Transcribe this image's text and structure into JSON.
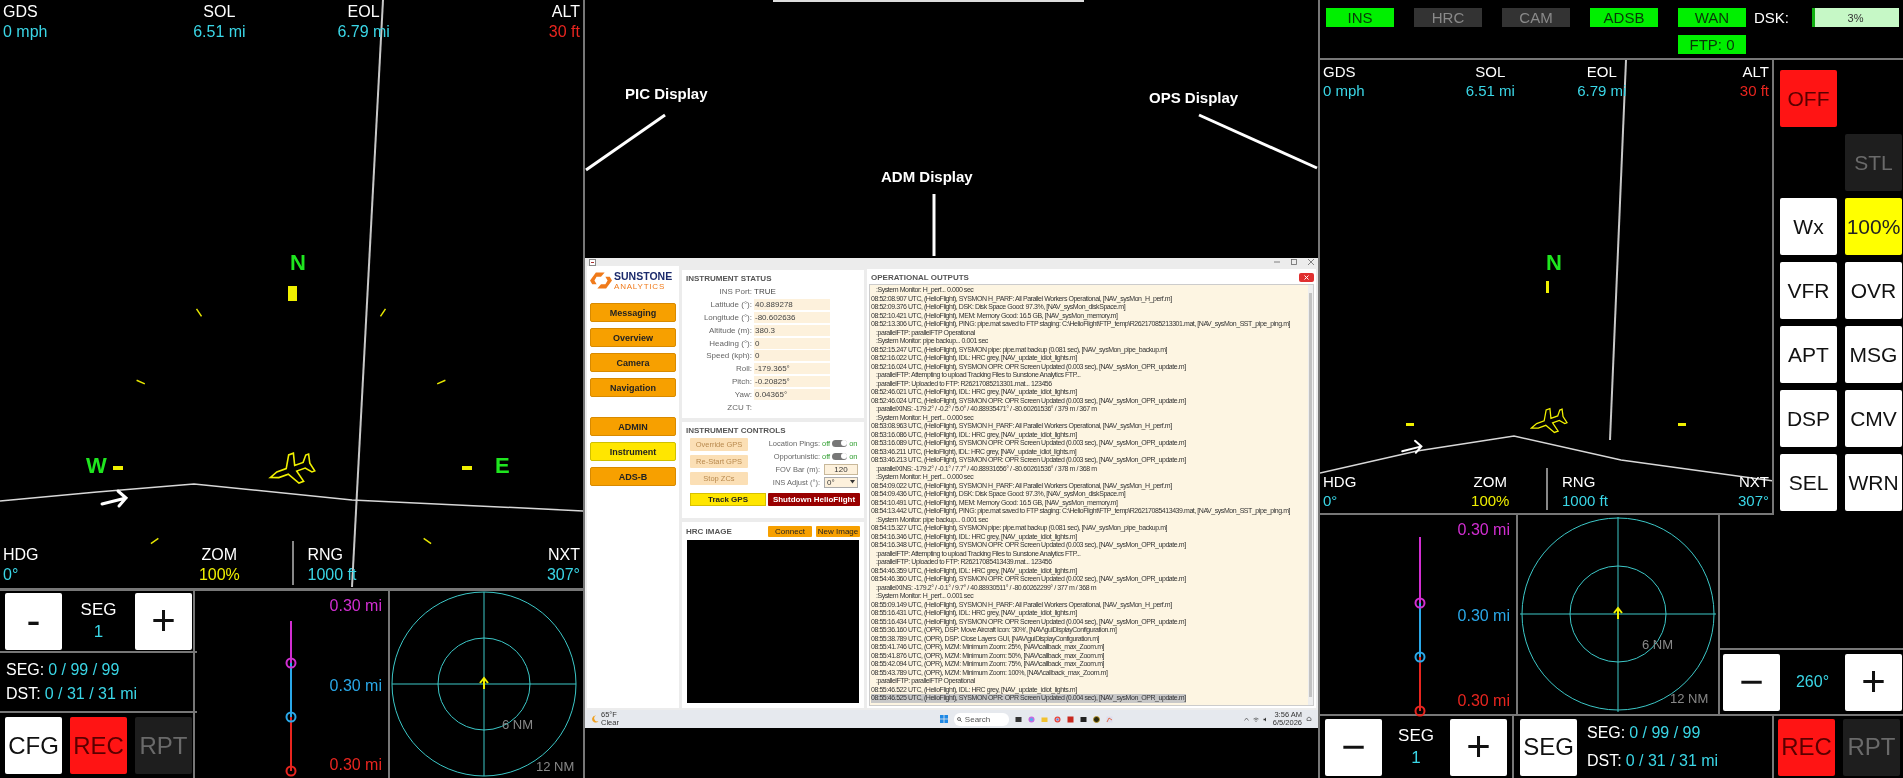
{
  "pic_display": {
    "map": {
      "top": [
        {
          "label": "GDS",
          "value": "0 mph",
          "color": "#3ad6e6"
        },
        {
          "label": "SOL",
          "value": "6.51 mi",
          "color": "#3ad6e6"
        },
        {
          "label": "EOL",
          "value": "6.79 mi",
          "color": "#3ad6e6"
        },
        {
          "label": "ALT",
          "value": "30 ft",
          "color": "#e8251f"
        }
      ],
      "compass": [
        {
          "letter": "N"
        },
        {
          "letter": "W"
        },
        {
          "letter": "E"
        }
      ],
      "bottom": [
        {
          "label": "HDG",
          "value": "0°",
          "color": "#3ad6e6"
        },
        {
          "label": "ZOM",
          "value": "100%",
          "color": "#f0f000"
        },
        {
          "label": "RNG",
          "value": "1000 ft",
          "color": "#3ad6e6"
        },
        {
          "label": "NXT",
          "value": "307°",
          "color": "#3ad6e6"
        }
      ]
    },
    "seg_control": {
      "minus": "-",
      "label": "SEG",
      "value": "1",
      "plus": "+"
    },
    "summary": [
      {
        "label": "SEG:",
        "value": "0 / 99 / 99"
      },
      {
        "label": "DST:",
        "value": "0 / 31 / 31 mi"
      }
    ],
    "buttons": [
      {
        "label": "CFG",
        "kind": "normal"
      },
      {
        "label": "REC",
        "kind": "alert"
      },
      {
        "label": "RPT",
        "kind": "disabled"
      }
    ],
    "profile": [
      {
        "text": "0.30 mi",
        "color": "#d22ed2"
      },
      {
        "text": "0.30 mi",
        "color": "#2aa8e8"
      },
      {
        "text": "0.30 mi",
        "color": "#e8251f"
      }
    ],
    "radar": [
      {
        "label": "6 NM"
      },
      {
        "label": "12 NM"
      }
    ]
  },
  "callouts": [
    {
      "label": "PIC Display"
    },
    {
      "label": "ADM Display"
    },
    {
      "label": "OPS Display"
    }
  ],
  "adm_display": {
    "logo": {
      "name": "SUNSTONE",
      "tagline": "ANALYTICS"
    },
    "nav_groups": [
      {
        "items": [
          {
            "label": "Messaging",
            "selected": false
          },
          {
            "label": "Overview",
            "selected": false
          },
          {
            "label": "Camera",
            "selected": false
          },
          {
            "label": "Navigation",
            "selected": false
          }
        ]
      },
      {
        "items": [
          {
            "label": "ADMIN",
            "selected": false
          },
          {
            "label": "Instrument",
            "selected": true
          },
          {
            "label": "ADS-B",
            "selected": false
          }
        ]
      }
    ],
    "instrument_status": {
      "title": "INSTRUMENT STATUS",
      "fields": [
        {
          "label": "INS Port:",
          "value": "TRUE",
          "kind": "plain"
        },
        {
          "label": "Latitude (°):",
          "value": "40.889278",
          "kind": "box"
        },
        {
          "label": "Longitude (°):",
          "value": "-80.602636",
          "kind": "box"
        },
        {
          "label": "Altitude (m):",
          "value": "380.3",
          "kind": "box"
        },
        {
          "label": "Heading (°):",
          "value": "0",
          "kind": "box"
        },
        {
          "label": "Speed (kph):",
          "value": "0",
          "kind": "box"
        },
        {
          "label": "Roll:",
          "value": "-179.365°",
          "kind": "box"
        },
        {
          "label": "Pitch:",
          "value": "-0.20825°",
          "kind": "box"
        },
        {
          "label": "Yaw:",
          "value": "0.04365°",
          "kind": "box"
        },
        {
          "label": "ZCU T:",
          "kind": "plain"
        }
      ]
    },
    "instrument_controls": {
      "title": "INSTRUMENT CONTROLS",
      "buttons": [
        {
          "label": "Override GPS",
          "disabled": true
        },
        {
          "label": "Re-Start GPS",
          "disabled": true
        },
        {
          "label": "Stop ZCs",
          "disabled": true
        }
      ],
      "toggles": [
        {
          "label": "Location Pings:",
          "off_label": "off",
          "on_label": "on",
          "on": true
        },
        {
          "label": "Opportunistic:",
          "off_label": "off",
          "on_label": "on",
          "on": true
        }
      ],
      "fov": {
        "label": "FOV Bar (m):",
        "value": "120"
      },
      "ins_adjust": {
        "label": "INS Adjust (°):",
        "value": "0°"
      },
      "track": "Track GPS",
      "shutdown": "Shutdown HelioFlight"
    },
    "hrc_image": {
      "title": "HRC IMAGE",
      "buttons": [
        "Connect",
        "New Image"
      ]
    },
    "outputs": {
      "title": "OPERATIONAL OUTPUTS",
      "lines": [
        {
          "text": ":System Monitor: H_perf... 0.000 sec",
          "kind": "sub",
          "selected": false
        },
        {
          "text": "08:52:08.907 UTC, (HelioFlight), SYSMON H_PARF: All Parallel Workers Operational, [NAV_sysMon_H_perf.m]",
          "kind": "entry",
          "selected": false
        },
        {
          "text": "08:52:09.376 UTC, (HelioFlight), DSK: Disk Space Good: 97.3%, [NAV_sysMon_diskSpace.m]",
          "kind": "entry",
          "selected": false
        },
        {
          "text": "08:52:10.421 UTC, (HelioFlight), MEM: Memory Good: 16.5 GB, [NAV_sysMon_memory.m]",
          "kind": "entry",
          "selected": false
        },
        {
          "text": "08:52:13.306 UTC, (HelioFlight), PING: pipe.mat saved to FTP staging: C:\\HelioFlight\\FTP_temp\\R26217085213301.mat, [NAV_sysMon_SST_pipe_ping.m]",
          "kind": "entry",
          "selected": false
        },
        {
          "text": ":parallelFTP: parallelFTP Operational",
          "kind": "sub",
          "selected": false
        },
        {
          "text": ":System Monitor: pipe backup... 0.001 sec",
          "kind": "sub",
          "selected": false
        },
        {
          "text": "08:52:15.247 UTC, (HelioFlight), SYSMON pipe: pipe.mat backup (0.081 sec), [NAV_sysMon_pipe_backup.m]",
          "kind": "entry",
          "selected": false
        },
        {
          "text": "08:52:16.022 UTC, (HelioFlight), IDL: HRC grey, [NAV_update_idiot_lights.m]",
          "kind": "entry",
          "selected": false
        },
        {
          "text": "08:52:16.024 UTC, (HelioFlight), SYSMON OPR: OPR Screen Updated (0.003 sec), [NAV_sysMon_OPR_update.m]",
          "kind": "entry",
          "selected": false
        },
        {
          "text": ":parallelFTP: Attempting to upload Tracking Files to Sunstone Analytics FTP...",
          "kind": "sub",
          "selected": false
        },
        {
          "text": ":parallelFTP: Uploaded to FTP: R26217085213301.mat... 123456",
          "kind": "sub",
          "selected": false
        },
        {
          "text": "08:52:46.021 UTC, (HelioFlight), IDL: HRC grey, [NAV_update_idiot_lights.m]",
          "kind": "entry",
          "selected": false
        },
        {
          "text": "08:52:46.024 UTC, (HelioFlight), SYSMON OPR: OPR Screen Updated (0.003 sec), [NAV_sysMon_OPR_update.m]",
          "kind": "entry",
          "selected": false
        },
        {
          "text": ":parallelXINS: -179.2° / -0.2° / 5.0° / 40.88935471° / -80.60261536° / 379 m / 367 m",
          "kind": "sub",
          "selected": false
        },
        {
          "text": ":System Monitor: H_perf... 0.000 sec",
          "kind": "sub",
          "selected": false
        },
        {
          "text": "08:53:08.963 UTC, (HelioFlight), SYSMON H_PARF: All Parallel Workers Operational, [NAV_sysMon_H_perf.m]",
          "kind": "entry",
          "selected": false
        },
        {
          "text": "08:53:16.086 UTC, (HelioFlight), IDL: HRC grey, [NAV_update_idiot_lights.m]",
          "kind": "entry",
          "selected": false
        },
        {
          "text": "08:53:16.089 UTC, (HelioFlight), SYSMON OPR: OPR Screen Updated (0.003 sec), [NAV_sysMon_OPR_update.m]",
          "kind": "entry",
          "selected": false
        },
        {
          "text": "08:53:46.211 UTC, (HelioFlight), IDL: HRC grey, [NAV_update_idiot_lights.m]",
          "kind": "entry",
          "selected": false
        },
        {
          "text": "08:53:46.213 UTC, (HelioFlight), SYSMON OPR: OPR Screen Updated (0.003 sec), [NAV_sysMon_OPR_update.m]",
          "kind": "entry",
          "selected": false
        },
        {
          "text": ":parallelXINS: -179.2° / -0.1° / 7.7° / 40.88931656° / -80.60261536° / 378 m / 368 m",
          "kind": "sub",
          "selected": false
        },
        {
          "text": ":System Monitor: H_perf... 0.000 sec",
          "kind": "sub",
          "selected": false
        },
        {
          "text": "08:54:09.022 UTC, (HelioFlight), SYSMON H_PARF: All Parallel Workers Operational, [NAV_sysMon_H_perf.m]",
          "kind": "entry",
          "selected": false
        },
        {
          "text": "08:54:09.436 UTC, (HelioFlight), DSK: Disk Space Good: 97.3%, [NAV_sysMon_diskSpace.m]",
          "kind": "entry",
          "selected": false
        },
        {
          "text": "08:54:10.491 UTC, (HelioFlight), MEM: Memory Good: 16.5 GB, [NAV_sysMon_memory.m]",
          "kind": "entry",
          "selected": false
        },
        {
          "text": "08:54:13.442 UTC, (HelioFlight), PING: pipe.mat saved to FTP staging: C:\\HelioFlight\\FTP_temp\\R26217085413439.mat, [NAV_sysMon_SST_pipe_ping.m]",
          "kind": "entry",
          "selected": false
        },
        {
          "text": ":System Monitor: pipe backup... 0.001 sec",
          "kind": "sub",
          "selected": false
        },
        {
          "text": "08:54:15.327 UTC, (HelioFlight), SYSMON pipe: pipe.mat backup (0.081 sec), [NAV_sysMon_pipe_backup.m]",
          "kind": "entry",
          "selected": false
        },
        {
          "text": "08:54:16.346 UTC, (HelioFlight), IDL: HRC grey, [NAV_update_idiot_lights.m]",
          "kind": "entry",
          "selected": false
        },
        {
          "text": "08:54:16.348 UTC, (HelioFlight), SYSMON OPR: OPR Screen Updated (0.003 sec), [NAV_sysMon_OPR_update.m]",
          "kind": "entry",
          "selected": false
        },
        {
          "text": ":parallelFTP: Attempting to upload Tracking Files to Sunstone Analytics FTP...",
          "kind": "sub",
          "selected": false
        },
        {
          "text": ":parallelFTP: Uploaded to FTP: R26217085413439.mat... 123456",
          "kind": "sub",
          "selected": false
        },
        {
          "text": "08:54:46.359 UTC, (HelioFlight), IDL: HRC grey, [NAV_update_idiot_lights.m]",
          "kind": "entry",
          "selected": false
        },
        {
          "text": "08:54:46.360 UTC, (HelioFlight), SYSMON OPR: OPR Screen Updated (0.002 sec), [NAV_sysMon_OPR_update.m]",
          "kind": "entry",
          "selected": false
        },
        {
          "text": ":parallelXINS: -179.2° / -0.1° / 9.7° / 40.88930511° / -80.60262299° / 377 m / 368 m",
          "kind": "sub",
          "selected": false
        },
        {
          "text": ":System Monitor: H_perf... 0.001 sec",
          "kind": "sub",
          "selected": false
        },
        {
          "text": "08:55:09.149 UTC, (HelioFlight), SYSMON H_PARF: All Parallel Workers Operational, [NAV_sysMon_H_perf.m]",
          "kind": "entry",
          "selected": false
        },
        {
          "text": "08:55:16.431 UTC, (HelioFlight), IDL: HRC grey, [NAV_update_idiot_lights.m]",
          "kind": "entry",
          "selected": false
        },
        {
          "text": "08:55:16.434 UTC, (HelioFlight), SYSMON OPR: OPR Screen Updated (0.004 sec), [NAV_sysMon_OPR_update.m]",
          "kind": "entry",
          "selected": false
        },
        {
          "text": "08:55:36.160 UTC, (OPR), DSP: Move Aircraft Icon: '30%', [NAV\\guiDisplayConfiguration.m]",
          "kind": "entry",
          "selected": false
        },
        {
          "text": "08:55:38.789 UTC, (OPR), DSP: Close Layers GUI, [NAV\\guiDisplayConfiguration.m]",
          "kind": "entry",
          "selected": false
        },
        {
          "text": "08:55:41.746 UTC, (OPR), MZM: Minimum Zoom: 25%, [NAV\\callback_max_Zoom.m]",
          "kind": "entry",
          "selected": false
        },
        {
          "text": "08:55:41.876 UTC, (OPR), MZM: Minimum Zoom: 50%, [NAV\\callback_max_Zoom.m]",
          "kind": "entry",
          "selected": false
        },
        {
          "text": "08:55:42.094 UTC, (OPR), MZM: Minimum Zoom: 75%, [NAV\\callback_max_Zoom.m]",
          "kind": "entry",
          "selected": false
        },
        {
          "text": "08:55:43.789 UTC, (OPR), MZM: Minimum Zoom: 100%, [NAV\\callback_max_Zoom.m]",
          "kind": "entry",
          "selected": false
        },
        {
          "text": ":parallelFTP: parallelFTP Operational",
          "kind": "sub",
          "selected": false
        },
        {
          "text": "08:55:46.522 UTC, (HelioFlight), IDL: HRC grey, [NAV_update_idiot_lights.m]",
          "kind": "entry",
          "selected": false
        },
        {
          "text": "08:55:46.525 UTC, (HelioFlight), SYSMON OPR: OPR Screen Updated (0.004 sec), [NAV_sysMon_OPR_update.m]",
          "kind": "entry",
          "selected": true
        }
      ]
    },
    "taskbar": {
      "temperature": "65°F",
      "condition": "Clear",
      "search": {
        "placeholder": "Search"
      },
      "time": "3:56 AM",
      "date": "6/5/2026"
    }
  },
  "ops_display": {
    "status": [
      {
        "label": "INS",
        "on": true
      },
      {
        "label": "HRC",
        "on": false
      },
      {
        "label": "CAM",
        "on": false
      },
      {
        "label": "ADSB",
        "on": true
      },
      {
        "label": "WAN",
        "on": true
      }
    ],
    "ftp": {
      "label": "FTP: 0",
      "on": true
    },
    "disk": {
      "label": "DSK:",
      "reading": "3%",
      "level": 0.03
    },
    "map": {
      "top": [
        {
          "label": "GDS",
          "value": "0 mph",
          "color": "#3ad6e6"
        },
        {
          "label": "SOL",
          "value": "6.51 mi",
          "color": "#3ad6e6"
        },
        {
          "label": "EOL",
          "value": "6.79 mi",
          "color": "#3ad6e6"
        },
        {
          "label": "ALT",
          "value": "30 ft",
          "color": "#e8251f"
        }
      ],
      "compass": [
        {
          "letter": "N"
        }
      ],
      "bottom": [
        {
          "label": "HDG",
          "value": "0°",
          "color": "#3ad6e6"
        },
        {
          "label": "ZOM",
          "value": "100%",
          "color": "#f0f000"
        },
        {
          "label": "RNG",
          "value": "1000 ft",
          "color": "#3ad6e6"
        },
        {
          "label": "NXT",
          "value": "307°",
          "color": "#3ad6e6"
        }
      ]
    },
    "side_buttons": [
      {
        "label": "OFF",
        "kind": "alert"
      },
      {
        "label": "STL",
        "kind": "disabled"
      },
      {
        "label": "Wx",
        "kind": "normal"
      },
      {
        "label": "100%",
        "kind": "highlight"
      },
      {
        "label": "VFR",
        "kind": "normal"
      },
      {
        "label": "OVR",
        "kind": "normal"
      },
      {
        "label": "APT",
        "kind": "normal"
      },
      {
        "label": "MSG",
        "kind": "normal"
      },
      {
        "label": "DSP",
        "kind": "normal"
      },
      {
        "label": "CMV",
        "kind": "normal"
      },
      {
        "label": "SEL",
        "kind": "normal"
      },
      {
        "label": "WRN",
        "kind": "normal"
      }
    ],
    "profile": [
      {
        "text": "0.30 mi",
        "color": "#d22ed2"
      },
      {
        "text": "0.30 mi",
        "color": "#2aa8e8"
      },
      {
        "text": "0.30 mi",
        "color": "#e8251f"
      }
    ],
    "radar": [
      {
        "label": "6 NM"
      },
      {
        "label": "12 NM"
      }
    ],
    "heading": {
      "minus": "−",
      "value": "260°",
      "plus": "+"
    },
    "seg_control": {
      "minus": "−",
      "label": "SEG",
      "value": "1",
      "plus": "+"
    },
    "seg_button": "SEG",
    "summary": [
      {
        "label": "SEG:",
        "value": "0 / 99 / 99"
      },
      {
        "label": "DST:",
        "value": "0 / 31 / 31 mi"
      }
    ],
    "buttons": [
      {
        "label": "REC",
        "kind": "alert"
      },
      {
        "label": "RPT",
        "kind": "disabled"
      }
    ]
  }
}
